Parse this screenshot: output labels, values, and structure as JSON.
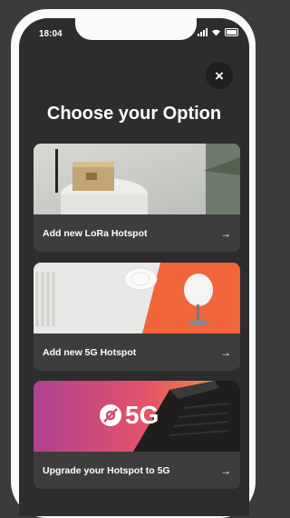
{
  "status": {
    "time": "18:04"
  },
  "header": {
    "title": "Choose your Option",
    "close_icon": "×"
  },
  "options": [
    {
      "label": "Add new LoRa Hotspot",
      "arrow": "→"
    },
    {
      "label": "Add new 5G Hotspot",
      "arrow": "→"
    },
    {
      "label": "Upgrade your Hotspot to 5G",
      "arrow": "→"
    }
  ],
  "promo": {
    "badge_text": "5G"
  },
  "colors": {
    "background": "#2d2d2d",
    "card": "#3d3d3d",
    "accent_orange": "#f0653a"
  }
}
